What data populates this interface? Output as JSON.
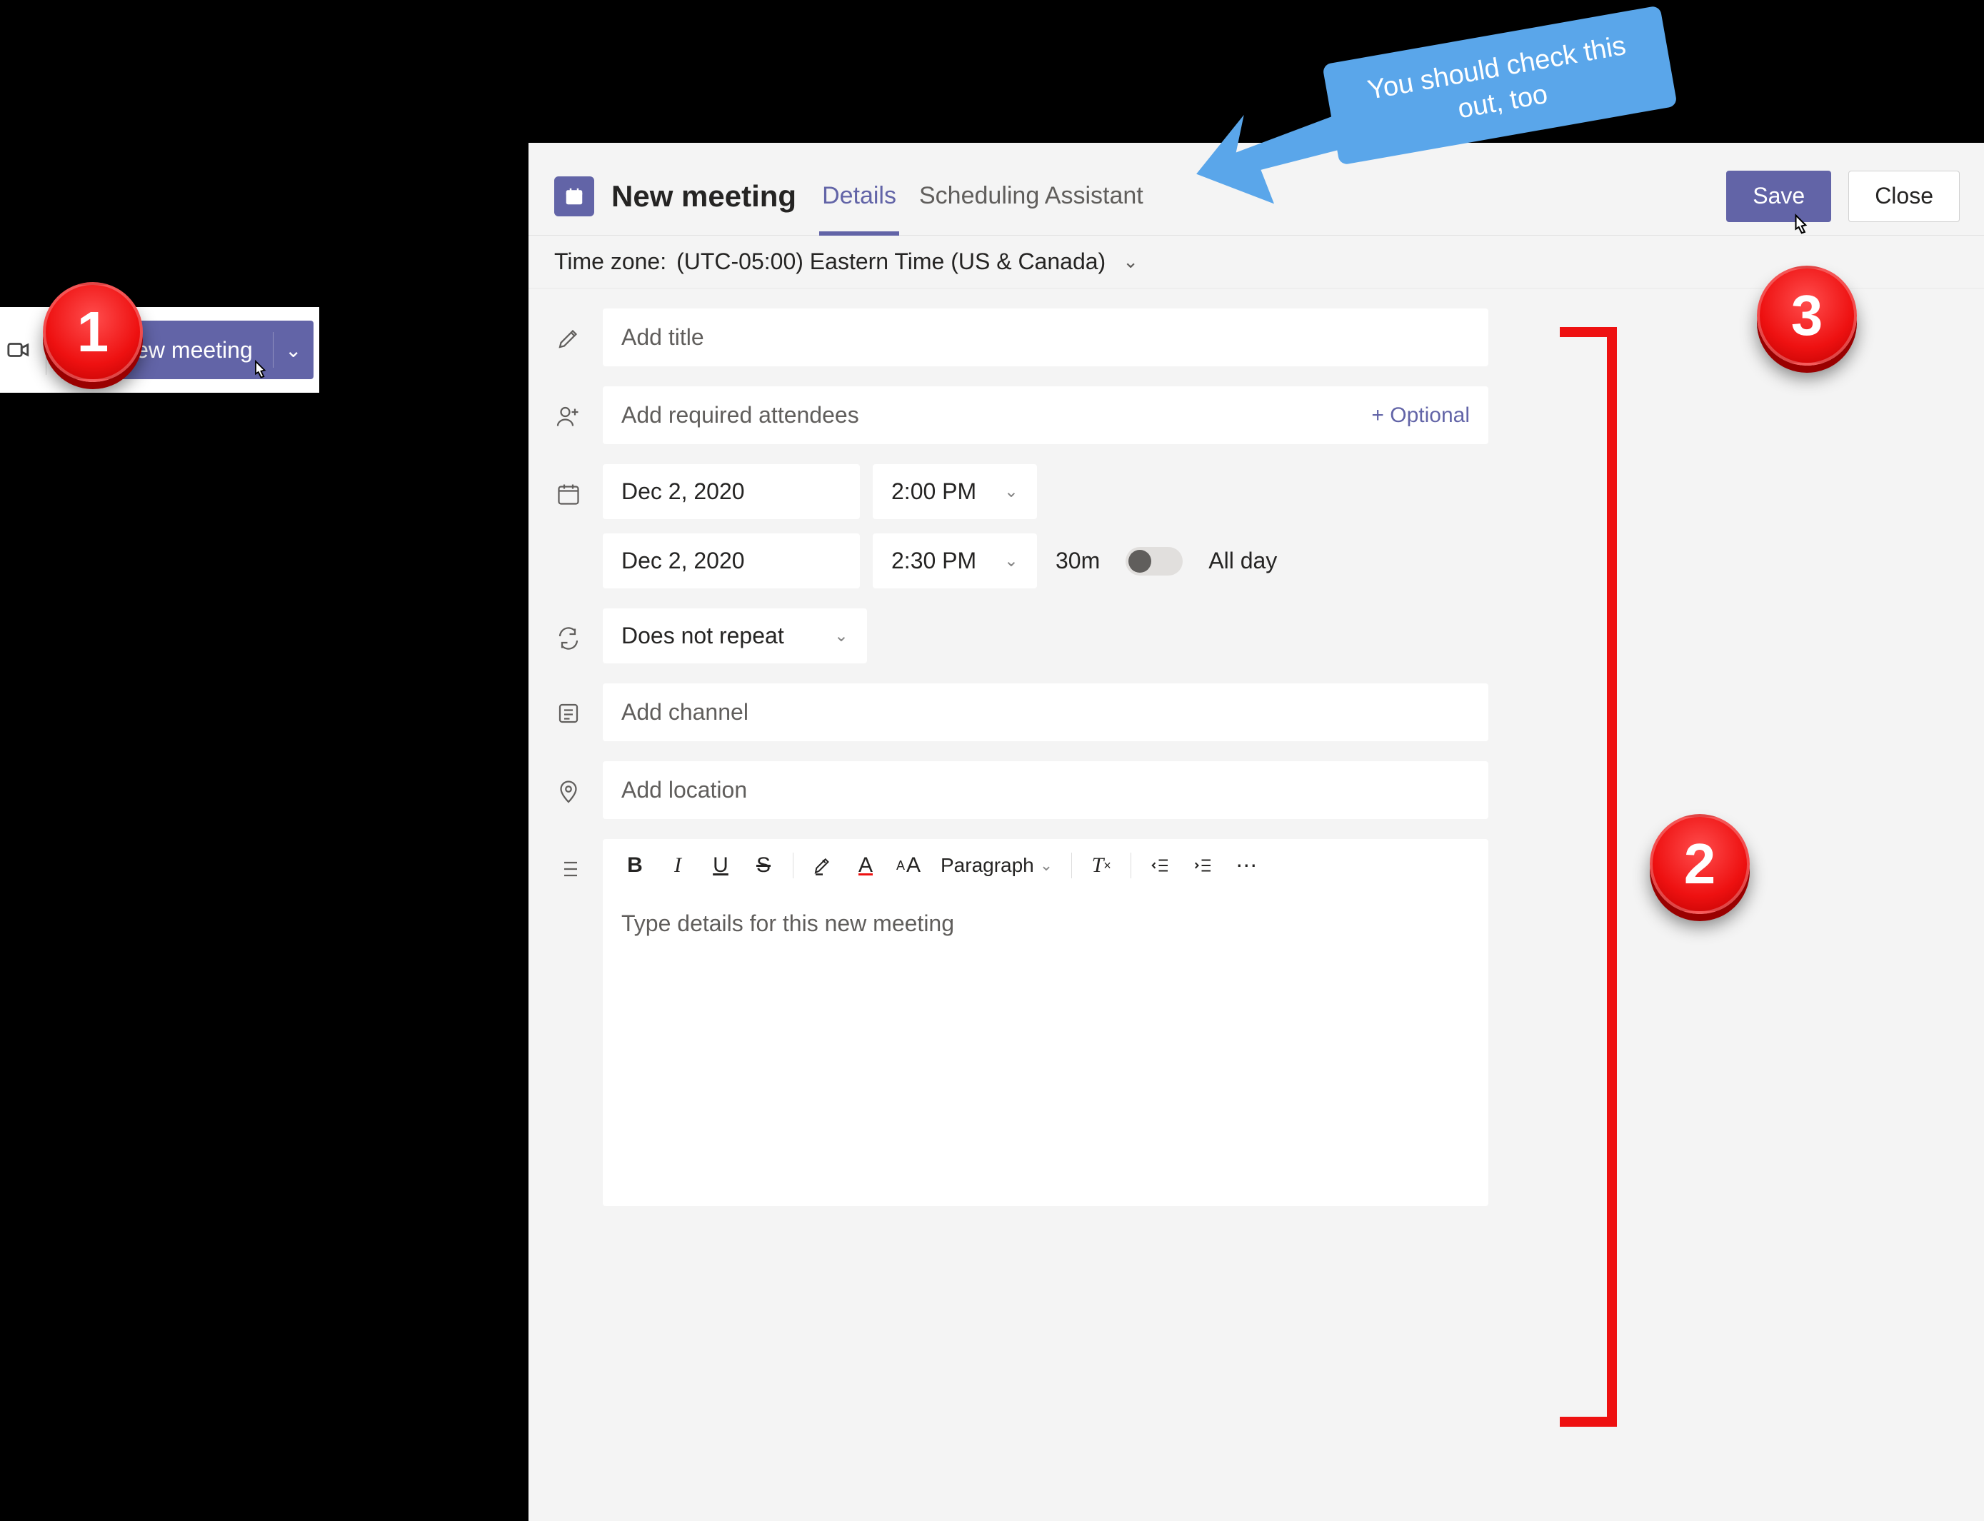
{
  "colors": {
    "primary": "#6264A7",
    "accent_red": "#e11",
    "callout_blue": "#5aa6ea"
  },
  "floating_button": {
    "label": "New meeting"
  },
  "header": {
    "title": "New meeting",
    "tabs": {
      "details": "Details",
      "scheduling": "Scheduling Assistant"
    },
    "save": "Save",
    "close": "Close"
  },
  "timezone": {
    "label": "Time zone:",
    "value": "(UTC-05:00) Eastern Time (US & Canada)"
  },
  "form": {
    "title_placeholder": "Add title",
    "attendees_placeholder": "Add required attendees",
    "optional_link": "+ Optional",
    "start_date": "Dec 2, 2020",
    "start_time": "2:00 PM",
    "end_date": "Dec 2, 2020",
    "end_time": "2:30 PM",
    "duration": "30m",
    "all_day": "All day",
    "repeat": "Does not repeat",
    "channel_placeholder": "Add channel",
    "location_placeholder": "Add location",
    "paragraph_label": "Paragraph",
    "details_placeholder": "Type details for this new meeting"
  },
  "annotations": {
    "badge1": "1",
    "badge2": "2",
    "badge3": "3",
    "callout": "You should check this out, too"
  }
}
